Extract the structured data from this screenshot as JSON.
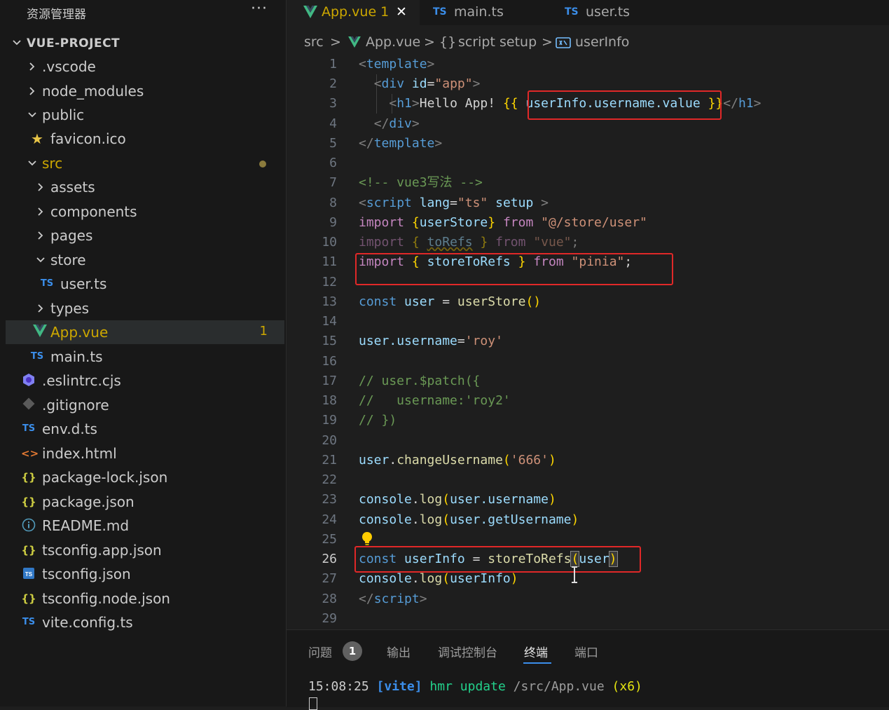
{
  "explorer": {
    "title": "资源管理器",
    "more": "···",
    "root": "VUE-PROJECT",
    "items": [
      {
        "label": ".vscode"
      },
      {
        "label": "node_modules"
      },
      {
        "label": "public"
      },
      {
        "label": "favicon.ico"
      },
      {
        "label": "src"
      },
      {
        "label": "assets"
      },
      {
        "label": "components"
      },
      {
        "label": "pages"
      },
      {
        "label": "store"
      },
      {
        "label": "user.ts",
        "icon_text": "TS"
      },
      {
        "label": "types"
      },
      {
        "label": "App.vue",
        "badge": "1"
      },
      {
        "label": "main.ts",
        "icon_text": "TS"
      },
      {
        "label": ".eslintrc.cjs"
      },
      {
        "label": ".gitignore"
      },
      {
        "label": "env.d.ts",
        "icon_text": "TS"
      },
      {
        "label": "index.html",
        "icon_text": "<>"
      },
      {
        "label": "package-lock.json",
        "icon_text": "{}"
      },
      {
        "label": "package.json",
        "icon_text": "{}"
      },
      {
        "label": "README.md",
        "icon_text": "i"
      },
      {
        "label": "tsconfig.app.json",
        "icon_text": "{}"
      },
      {
        "label": "tsconfig.json",
        "icon_text": "TS"
      },
      {
        "label": "tsconfig.node.json",
        "icon_text": "{}"
      },
      {
        "label": "vite.config.ts",
        "icon_text": "TS"
      }
    ]
  },
  "tabs": [
    {
      "label": "App.vue 1",
      "close": "✕"
    },
    {
      "label": "main.ts",
      "icon_text": "TS"
    },
    {
      "label": "user.ts",
      "icon_text": "TS"
    }
  ],
  "breadcrumb": {
    "src": "src",
    "file": "App.vue",
    "scope_icon": "{}",
    "scope": "script setup",
    "symbol": "userInfo",
    "sep": ">"
  },
  "editor": {
    "current_line": 26,
    "line_numbers": [
      "1",
      "2",
      "3",
      "4",
      "5",
      "6",
      "7",
      "8",
      "9",
      "10",
      "11",
      "12",
      "13",
      "14",
      "15",
      "16",
      "17",
      "18",
      "19",
      "20",
      "21",
      "22",
      "23",
      "24",
      "25",
      "26",
      "27",
      "28",
      "29"
    ],
    "tokens": {
      "l1_open": "<",
      "l1_tag": "template",
      "l1_close": ">",
      "l2_open": "<",
      "l2_tag": "div",
      "l2_attr": "id",
      "l2_eq": "=",
      "l2_val": "\"app\"",
      "l2_close": ">",
      "l3_open": "<",
      "l3_tag": "h1",
      "l3_close": ">",
      "l3_text": "Hello App! ",
      "l3_mopen": "{{",
      "l3_expr": "userInfo.username.value",
      "l3_mclose": "}}",
      "l3_end": "</",
      "l3_endtag": "h1",
      "l3_endclose": ">",
      "l4_open": "</",
      "l4_tag": "div",
      "l4_close": ">",
      "l5_open": "</",
      "l5_tag": "template",
      "l5_close": ">",
      "l7_comment": "<!-- vue3写法 -->",
      "l8_open": "<",
      "l8_tag": "script",
      "l8_attr": "lang",
      "l8_eq": "=",
      "l8_val": "\"ts\"",
      "l8_attr2": "setup",
      "l8_close": ">",
      "l9_import": "import",
      "l9_bo": "{",
      "l9_name": "userStore",
      "l9_bc": "}",
      "l9_from": "from",
      "l9_path": "\"@/store/user\"",
      "l10_import": "import",
      "l10_bo": "{",
      "l10_name": "toRefs",
      "l10_bc": "}",
      "l10_from": "from",
      "l10_path": "\"vue\"",
      "l10_semi": ";",
      "l11_import": "import",
      "l11_bo": "{",
      "l11_name": "storeToRefs",
      "l11_bc": "}",
      "l11_from": "from",
      "l11_path": "\"pinia\"",
      "l11_semi": ";",
      "l13_const": "const",
      "l13_var": "user",
      "l13_eq": " = ",
      "l13_fn": "userStore",
      "l13_paren": "()",
      "l15_obj": "user",
      "l15_prop": ".username",
      "l15_eq": "=",
      "l15_str": "'roy'",
      "l17_cmt": "// user.$patch({",
      "l18_cmt": "//   username:'roy2'",
      "l19_cmt": "// })",
      "l21_obj": "user",
      "l21_dot": ".",
      "l21_fn": "changeUsername",
      "l21_po": "(",
      "l21_str": "'666'",
      "l21_pc": ")",
      "l23_obj": "console",
      "l23_dot": ".",
      "l23_fn": "log",
      "l23_po": "(",
      "l23_arg": "user.username",
      "l23_pc": ")",
      "l24_obj": "console",
      "l24_dot": ".",
      "l24_fn": "log",
      "l24_po": "(",
      "l24_arg": "user.getUsername",
      "l24_pc": ")",
      "l26_const": "const",
      "l26_var": "userInfo",
      "l26_eq": " = ",
      "l26_fn": "storeToRefs",
      "l26_po": "(",
      "l26_arg": "user",
      "l26_pc": ")",
      "l27_obj": "console",
      "l27_dot": ".",
      "l27_fn": "log",
      "l27_po": "(",
      "l27_arg": "userInfo",
      "l27_pc": ")",
      "l28_open": "</",
      "l28_tag": "script",
      "l28_close": ">"
    }
  },
  "panel": {
    "tabs": [
      "问题",
      "输出",
      "调试控制台",
      "终端",
      "端口"
    ],
    "problems_count": "1",
    "active_tab": "终端",
    "terminal": {
      "time": "15:08:25",
      "tag": "[vite]",
      "msg": "hmr update",
      "path": "/src/App.vue",
      "count": "(x6)"
    }
  },
  "colors": {
    "accent": "#3b8eea",
    "highlight_box": "#e02828",
    "vue_green": "#41b883",
    "warning": "#cca700"
  }
}
